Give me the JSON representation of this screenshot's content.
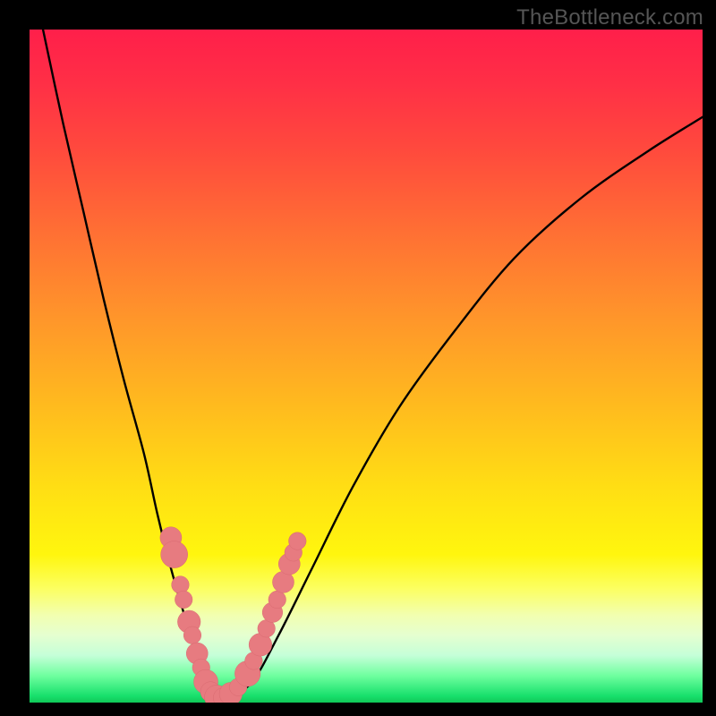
{
  "watermark": "TheBottleneck.com",
  "colors": {
    "frame": "#000000",
    "curve": "#000000",
    "marker_fill": "#e77b80",
    "marker_stroke": "#d96a70"
  },
  "chart_data": {
    "type": "line",
    "title": "",
    "xlabel": "",
    "ylabel": "",
    "xlim": [
      0,
      100
    ],
    "ylim": [
      0,
      100
    ],
    "note": "Axes carry no tick labels; values are approximate positions read from the plot in percent of plot area (x from left, y as height above bottom).",
    "series": [
      {
        "name": "bottleneck-curve",
        "x": [
          2,
          5,
          8,
          11,
          14,
          17,
          19,
          21,
          23,
          24.5,
          26,
          27.5,
          29,
          33,
          37,
          42,
          48,
          55,
          63,
          72,
          82,
          92,
          100
        ],
        "y": [
          100,
          86,
          73,
          60,
          48,
          37,
          28,
          20,
          13,
          8,
          4,
          1.5,
          0.5,
          3,
          10,
          20,
          32,
          44,
          55,
          66,
          75,
          82,
          87
        ]
      }
    ],
    "markers": {
      "name": "highlighted-points",
      "note": "Salmon dot clusters near the valley; approximate.",
      "points": [
        {
          "x": 21.0,
          "y": 24.5,
          "r": 1.6
        },
        {
          "x": 21.5,
          "y": 22.0,
          "r": 2.0
        },
        {
          "x": 22.4,
          "y": 17.5,
          "r": 1.3
        },
        {
          "x": 22.9,
          "y": 15.3,
          "r": 1.3
        },
        {
          "x": 23.7,
          "y": 12.0,
          "r": 1.7
        },
        {
          "x": 24.2,
          "y": 10.0,
          "r": 1.3
        },
        {
          "x": 24.9,
          "y": 7.3,
          "r": 1.6
        },
        {
          "x": 25.5,
          "y": 5.2,
          "r": 1.3
        },
        {
          "x": 26.2,
          "y": 3.1,
          "r": 1.8
        },
        {
          "x": 26.9,
          "y": 1.6,
          "r": 1.5
        },
        {
          "x": 27.8,
          "y": 0.8,
          "r": 1.8
        },
        {
          "x": 28.8,
          "y": 0.7,
          "r": 1.5
        },
        {
          "x": 29.9,
          "y": 1.3,
          "r": 1.7
        },
        {
          "x": 31.0,
          "y": 2.3,
          "r": 1.3
        },
        {
          "x": 32.4,
          "y": 4.3,
          "r": 1.9
        },
        {
          "x": 33.3,
          "y": 6.2,
          "r": 1.3
        },
        {
          "x": 34.3,
          "y": 8.6,
          "r": 1.7
        },
        {
          "x": 35.2,
          "y": 11.0,
          "r": 1.3
        },
        {
          "x": 36.1,
          "y": 13.4,
          "r": 1.5
        },
        {
          "x": 36.8,
          "y": 15.3,
          "r": 1.3
        },
        {
          "x": 37.7,
          "y": 17.9,
          "r": 1.6
        },
        {
          "x": 38.6,
          "y": 20.6,
          "r": 1.6
        },
        {
          "x": 39.2,
          "y": 22.3,
          "r": 1.3
        },
        {
          "x": 39.8,
          "y": 24.0,
          "r": 1.3
        }
      ]
    }
  }
}
